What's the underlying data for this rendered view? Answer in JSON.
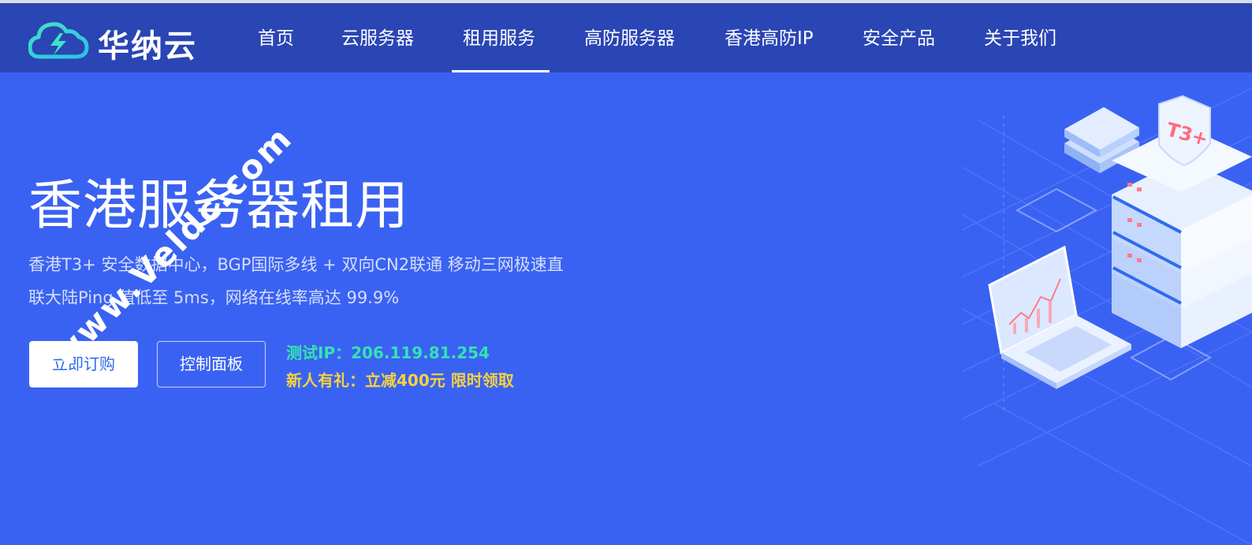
{
  "brand": {
    "name": "华纳云",
    "logo_icon": "cloud-lightning-icon",
    "colors": {
      "primary": "#2a45b4",
      "hero": "#3a62f2",
      "accent_green": "#34e3b2",
      "accent_yellow": "#f6d23e"
    }
  },
  "nav": {
    "items": [
      {
        "label": "首页"
      },
      {
        "label": "云服务器"
      },
      {
        "label": "租用服务",
        "active": true
      },
      {
        "label": "高防服务器"
      },
      {
        "label": "香港高防IP"
      },
      {
        "label": "安全产品"
      },
      {
        "label": "关于我们"
      }
    ]
  },
  "hero": {
    "title": "香港服务器租用",
    "line1": "香港T3+ 安全数据中心，BGP国际多线 + 双向CN2联通 移动三网极速直",
    "line2": "联大陆Ping 值低至 5ms，网络在线率高达 99.9%",
    "buy_label": "立即订购",
    "panel_label": "控制面板",
    "test_ip": "测试IP：206.119.81.254",
    "promo": "新人有礼：立减400元 限时领取",
    "illustration_badge": "T3+"
  },
  "watermark": "www.Veldc.com"
}
